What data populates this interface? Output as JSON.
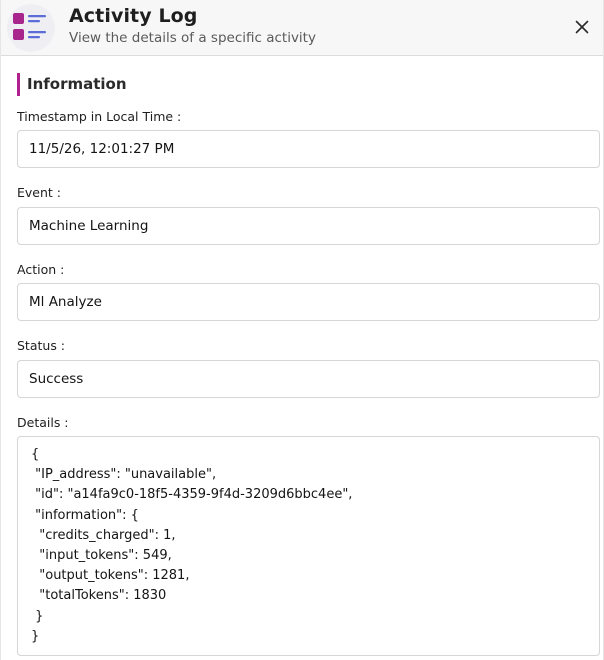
{
  "header": {
    "title": "Activity Log",
    "subtitle": "View the details of a specific activity"
  },
  "section": {
    "title": "Information"
  },
  "fields": {
    "timestamp": {
      "label": "Timestamp in Local Time :",
      "value": "11/5/26, 12:01:27 PM"
    },
    "event": {
      "label": "Event :",
      "value": "Machine Learning"
    },
    "action": {
      "label": "Action :",
      "value": "Ml Analyze"
    },
    "status": {
      "label": "Status :",
      "value": "Success"
    },
    "details": {
      "label": "Details :",
      "value": "{\n \"IP_address\": \"unavailable\",\n \"id\": \"a14fa9c0-18f5-4359-9f4d-3209d6bbc4ee\",\n \"information\": {\n  \"credits_charged\": 1,\n  \"input_tokens\": 549,\n  \"output_tokens\": 1281,\n  \"totalTokens\": 1830\n }\n}"
    }
  },
  "icons": {
    "app": "activity-list-icon",
    "close": "close-icon"
  },
  "colors": {
    "accent": "#b0218f",
    "icon_square": "#a8268c",
    "icon_lines": "#5a6dd8"
  }
}
